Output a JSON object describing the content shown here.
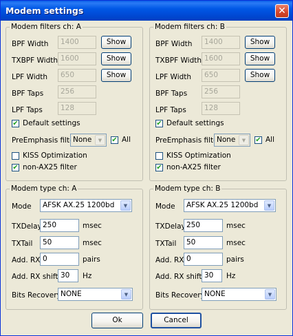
{
  "window": {
    "title": "Modem settings",
    "close_glyph": "✕"
  },
  "filters": [
    {
      "legend": "Modem filters ch: A",
      "bpf_width": "1400",
      "txbpf_width": "1600",
      "lpf_width": "650",
      "bpf_taps": "256",
      "lpf_taps": "128",
      "default_settings_checked": true,
      "preemphasis_value": "None",
      "all_checked": true,
      "kiss_checked": false,
      "nonax25_checked": true
    },
    {
      "legend": "Modem filters ch: B",
      "bpf_width": "1400",
      "txbpf_width": "1600",
      "lpf_width": "650",
      "bpf_taps": "256",
      "lpf_taps": "128",
      "default_settings_checked": true,
      "preemphasis_value": "None",
      "all_checked": true,
      "kiss_checked": false,
      "nonax25_checked": true
    }
  ],
  "types": [
    {
      "legend": "Modem type ch: A",
      "mode": "AFSK AX.25 1200bd",
      "txdelay": "250",
      "txtail": "50",
      "add_rx": "0",
      "add_rx_shift": "30",
      "bits_recovery": "NONE"
    },
    {
      "legend": "Modem type ch: B",
      "mode": "AFSK AX.25 1200bd",
      "txdelay": "250",
      "txtail": "50",
      "add_rx": "0",
      "add_rx_shift": "30",
      "bits_recovery": "NONE"
    }
  ],
  "labels": {
    "bpf_width": "BPF Width",
    "txbpf_width": "TXBPF Width",
    "lpf_width": "LPF Width",
    "bpf_taps": "BPF Taps",
    "lpf_taps": "LPF Taps",
    "show": "Show",
    "default_settings": "Default settings",
    "preemphasis": "PreEmphasis filter",
    "all": "All",
    "kiss": "KISS Optimization",
    "nonax25": "non-AX25 filter",
    "mode": "Mode",
    "txdelay": "TXDelay",
    "txtail": "TXTail",
    "add_rx": "Add. RX",
    "add_rx_shift": "Add. RX shift",
    "bits_recovery": "Bits Recovery",
    "msec": "msec",
    "pairs": "pairs",
    "hz": "Hz"
  },
  "buttons": {
    "ok": "Ok",
    "cancel": "Cancel"
  },
  "icons": {
    "checkmark": "✔",
    "dropdown": "▼"
  }
}
